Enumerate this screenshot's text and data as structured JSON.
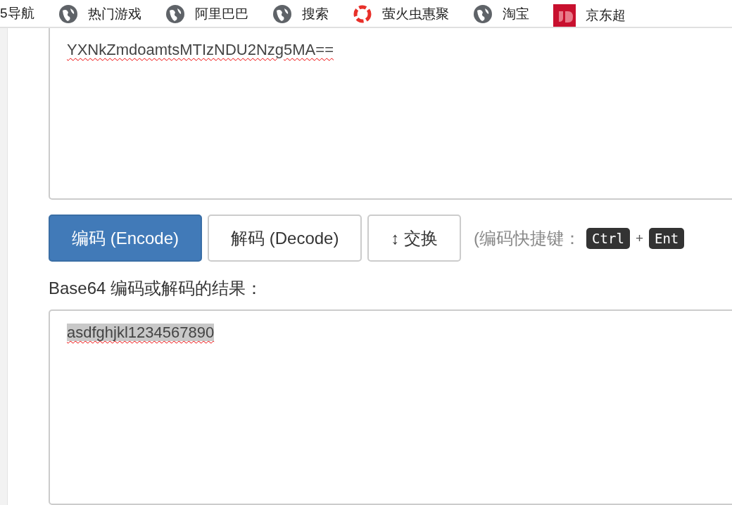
{
  "bookmarks": [
    {
      "label": "5导航",
      "kind": "plain"
    },
    {
      "label": "热门游戏",
      "kind": "globe"
    },
    {
      "label": "阿里巴巴",
      "kind": "globe"
    },
    {
      "label": "搜索",
      "kind": "globe"
    },
    {
      "label": "萤火虫惠聚",
      "kind": "ring"
    },
    {
      "label": "淘宝",
      "kind": "globe"
    },
    {
      "label": "京东超",
      "kind": "square"
    }
  ],
  "input": {
    "value": "YXNkZmdoamtsMTIzNDU2Nzg5MA=="
  },
  "buttons": [
    {
      "label": "编码 (Encode)",
      "primary": true
    },
    {
      "label": "解码 (Decode)",
      "primary": false
    },
    {
      "label": "↕ 交换",
      "primary": false
    }
  ],
  "shortcut_hint": {
    "text": "(编码快捷键：",
    "keys": [
      "Ctrl",
      "Ent"
    ],
    "plus": "+"
  },
  "result_label": "Base64 编码或解码的结果：",
  "output": {
    "value": "asdfghjkl1234567890",
    "selected": true
  }
}
